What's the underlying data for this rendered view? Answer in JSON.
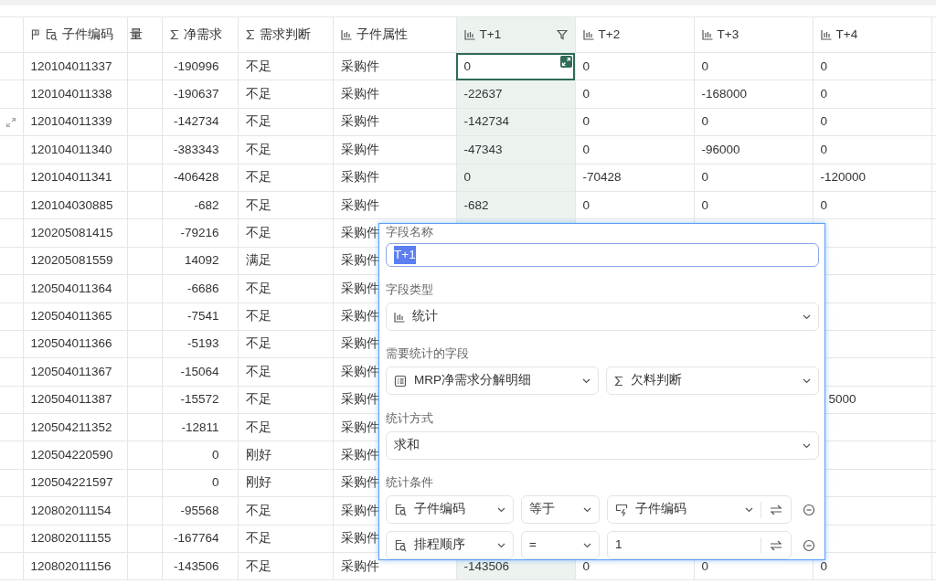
{
  "table": {
    "columns": [
      {
        "label": "子件编码",
        "kind": "lookup",
        "primary": true,
        "selected": false,
        "filtered": false
      },
      {
        "label": "量",
        "kind": "plain",
        "primary": false,
        "selected": false,
        "filtered": false
      },
      {
        "label": "净需求",
        "kind": "formula",
        "primary": false,
        "selected": false,
        "filtered": false
      },
      {
        "label": "需求判断",
        "kind": "formula",
        "primary": false,
        "selected": false,
        "filtered": false
      },
      {
        "label": "子件属性",
        "kind": "statistic",
        "primary": false,
        "selected": false,
        "filtered": false
      },
      {
        "label": "T+1",
        "kind": "statistic",
        "primary": false,
        "selected": true,
        "filtered": true
      },
      {
        "label": "T+2",
        "kind": "statistic",
        "primary": false,
        "selected": false,
        "filtered": false
      },
      {
        "label": "T+3",
        "kind": "statistic",
        "primary": false,
        "selected": false,
        "filtered": false
      },
      {
        "label": "T+4",
        "kind": "statistic",
        "primary": false,
        "selected": false,
        "filtered": false
      }
    ],
    "rows": [
      {
        "hovered": false,
        "cell_active": true,
        "code": "120104011337",
        "net": "-190996",
        "judge": "不足",
        "attr": "采购件",
        "t": {
          "t1": "0",
          "t2": "0",
          "t3": "0",
          "t4": "0"
        }
      },
      {
        "hovered": false,
        "cell_active": false,
        "code": "120104011338",
        "net": "-190637",
        "judge": "不足",
        "attr": "采购件",
        "t": {
          "t1": "-22637",
          "t2": "0",
          "t3": "-168000",
          "t4": "0"
        }
      },
      {
        "hovered": true,
        "cell_active": false,
        "code": "120104011339",
        "net": "-142734",
        "judge": "不足",
        "attr": "采购件",
        "t": {
          "t1": "-142734",
          "t2": "0",
          "t3": "0",
          "t4": "0"
        }
      },
      {
        "hovered": false,
        "cell_active": false,
        "code": "120104011340",
        "net": "-383343",
        "judge": "不足",
        "attr": "采购件",
        "t": {
          "t1": "-47343",
          "t2": "0",
          "t3": "-96000",
          "t4": "0"
        }
      },
      {
        "hovered": false,
        "cell_active": false,
        "code": "120104011341",
        "net": "-406428",
        "judge": "不足",
        "attr": "采购件",
        "t": {
          "t1": "0",
          "t2": "-70428",
          "t3": "0",
          "t4": "-120000"
        }
      },
      {
        "hovered": false,
        "cell_active": false,
        "code": "120104030885",
        "net": "-682",
        "judge": "不足",
        "attr": "采购件",
        "t": {
          "t1": "-682",
          "t2": "0",
          "t3": "0",
          "t4": "0"
        }
      },
      {
        "hovered": false,
        "code": "120205081415",
        "net": "-79216",
        "judge": "不足",
        "attr": "采购件",
        "t": {}
      },
      {
        "hovered": false,
        "code": "120205081559",
        "net": "14092",
        "judge": "满足",
        "attr": "采购件",
        "t": {}
      },
      {
        "hovered": false,
        "code": "120504011364",
        "net": "-6686",
        "judge": "不足",
        "attr": "采购件",
        "t": {}
      },
      {
        "hovered": false,
        "code": "120504011365",
        "net": "-7541",
        "judge": "不足",
        "attr": "采购件",
        "t": {}
      },
      {
        "hovered": false,
        "code": "120504011366",
        "net": "-5193",
        "judge": "不足",
        "attr": "采购件",
        "t": {}
      },
      {
        "hovered": false,
        "code": "120504011367",
        "net": "-15064",
        "judge": "不足",
        "attr": "采购件",
        "t": {}
      },
      {
        "hovered": false,
        "code": "120504011387",
        "net": "-15572",
        "judge": "不足",
        "attr": "采购件",
        "t": {
          "t4": "5000"
        }
      },
      {
        "hovered": false,
        "code": "120504211352",
        "net": "-12811",
        "judge": "不足",
        "attr": "采购件",
        "t": {}
      },
      {
        "hovered": false,
        "code": "120504220590",
        "net": "0",
        "judge": "刚好",
        "attr": "采购件",
        "t": {}
      },
      {
        "hovered": false,
        "code": "120504221597",
        "net": "0",
        "judge": "刚好",
        "attr": "采购件",
        "t": {}
      },
      {
        "hovered": false,
        "code": "120802011154",
        "net": "-95568",
        "judge": "不足",
        "attr": "采购件",
        "t": {}
      },
      {
        "hovered": false,
        "code": "120802011155",
        "net": "-167764",
        "judge": "不足",
        "attr": "采购件",
        "t": {}
      },
      {
        "hovered": false,
        "cell_active": false,
        "code": "120802011156",
        "net": "-143506",
        "judge": "不足",
        "attr": "采购件",
        "t": {
          "t1": "-143506",
          "t2": "0",
          "t3": "0",
          "t4": "0"
        }
      }
    ]
  },
  "field_editor": {
    "name_label": "字段名称",
    "name_value": "T+1",
    "name_selected": true,
    "type_label": "字段类型",
    "type": {
      "kind": "statistic",
      "value": "统计"
    },
    "source_label": "需要统计的字段",
    "source_table": {
      "kind": "table",
      "value": "MRP净需求分解明细"
    },
    "source_field": {
      "kind": "formula",
      "value": "欠料判断"
    },
    "method_label": "统计方式",
    "method": {
      "value": "求和"
    },
    "conditions_label": "统计条件",
    "conditions": [
      {
        "field": {
          "kind": "lookup",
          "value": "子件编码"
        },
        "operator": "等于",
        "target": {
          "kind": "field",
          "value": "子件编码"
        }
      },
      {
        "field": {
          "kind": "lookup",
          "value": "排程顺序"
        },
        "operator": "=",
        "target": {
          "kind": "constant",
          "value": "1"
        }
      }
    ]
  }
}
